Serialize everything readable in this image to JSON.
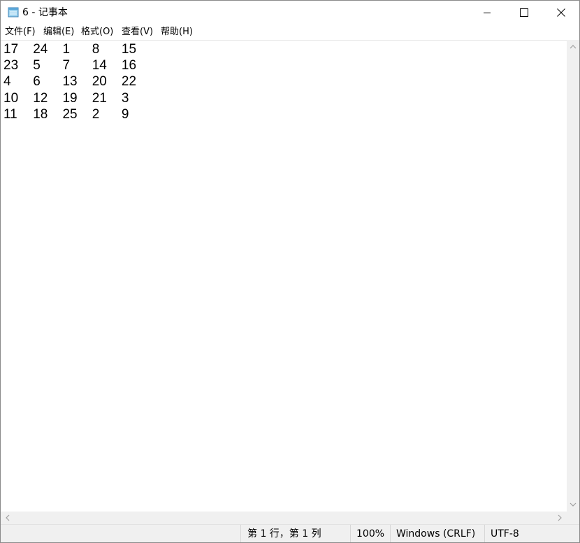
{
  "window": {
    "title": "6 - 记事本",
    "icon": "notepad-icon"
  },
  "controls": {
    "minimize_icon": "minimize-icon",
    "maximize_icon": "maximize-icon",
    "close_icon": "close-icon"
  },
  "menu": {
    "items": [
      "文件(F)",
      "编辑(E)",
      "格式(O)",
      "查看(V)",
      "帮助(H)"
    ]
  },
  "document": {
    "text": "17\t24\t1\t8\t15\n23\t5\t7\t14\t16\n4\t6\t13\t20\t22\n10\t12\t19\t21\t3\n11\t18\t25\t2\t9"
  },
  "status": {
    "position": "第 1 行，第 1 列",
    "zoom": "100%",
    "line_ending": "Windows (CRLF)",
    "encoding": "UTF-8"
  },
  "colors": {
    "chrome": "#f0f0f0",
    "text": "#000000",
    "arrow": "#a0a0a0"
  }
}
